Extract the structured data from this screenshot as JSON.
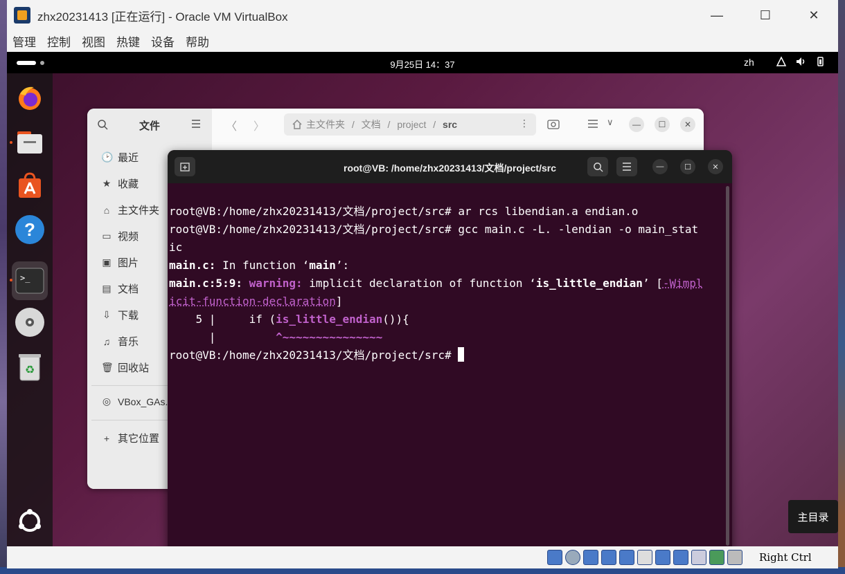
{
  "window": {
    "title": "zhx20231413 [正在运行] - Oracle VM VirtualBox",
    "minimize": "—",
    "maximize": "☐",
    "close": "✕"
  },
  "menubar": [
    "管理",
    "控制",
    "视图",
    "热键",
    "设备",
    "帮助"
  ],
  "gnome_topbar": {
    "clock": "9月25日  14：37",
    "input_method": "zh"
  },
  "dock": {
    "items": [
      "firefox-icon",
      "files-icon",
      "app-center-icon",
      "help-icon",
      "terminal-icon",
      "disc-icon",
      "trash-icon",
      "show-apps-icon"
    ]
  },
  "files_window": {
    "title": "文件",
    "path": [
      "主文件夹",
      "文档",
      "project",
      "src"
    ],
    "sidebar": [
      {
        "icon": "🕑",
        "label": "最近"
      },
      {
        "icon": "★",
        "label": "收藏"
      },
      {
        "icon": "⌂",
        "label": "主文件夹"
      },
      {
        "icon": "▭",
        "label": "视频"
      },
      {
        "icon": "▣",
        "label": "图片"
      },
      {
        "icon": "▤",
        "label": "文档"
      },
      {
        "icon": "⇩",
        "label": "下载"
      },
      {
        "icon": "♫",
        "label": "音乐"
      },
      {
        "icon": "🗑",
        "label": "回收站"
      }
    ],
    "devices": [
      {
        "icon": "◎",
        "label": "VBox_GAs..."
      }
    ],
    "other": {
      "icon": "+",
      "label": "其它位置"
    }
  },
  "terminal": {
    "title": "root@VB: /home/zhx20231413/文档/project/src",
    "lines": {
      "l1": "root@VB:/home/zhx20231413/文档/project/src# ar rcs libendian.a endian.o",
      "l2": "root@VB:/home/zhx20231413/文档/project/src# gcc main.c -L. -lendian -o main_stat",
      "l3": "ic",
      "l4a": "main.c:",
      "l4b": " In function ‘",
      "l4c": "main",
      "l4d": "’:",
      "l5a": "main.c:5:9: ",
      "l5b": "warning: ",
      "l5c": "implicit declaration of function ‘",
      "l5d": "is_little_endian",
      "l5e": "’ [",
      "l5f": "-Wimpl",
      "l6a": "icit-function-declaration",
      "l6b": "]",
      "l7a": "    5 |     if (",
      "l7b": "is_little_endian",
      "l7c": "()){",
      "l8a": "      |         ",
      "l8b": "^~~~~~~~~~~~~~~~",
      "l9": "root@VB:/home/zhx20231413/文档/project/src# "
    }
  },
  "tooltip": "主目录",
  "statusbar": {
    "host_key": "Right Ctrl"
  },
  "colors": {
    "terminal_bg": "#300a24",
    "warning": "#c061cb",
    "ubuntu_orange": "#e95420"
  }
}
